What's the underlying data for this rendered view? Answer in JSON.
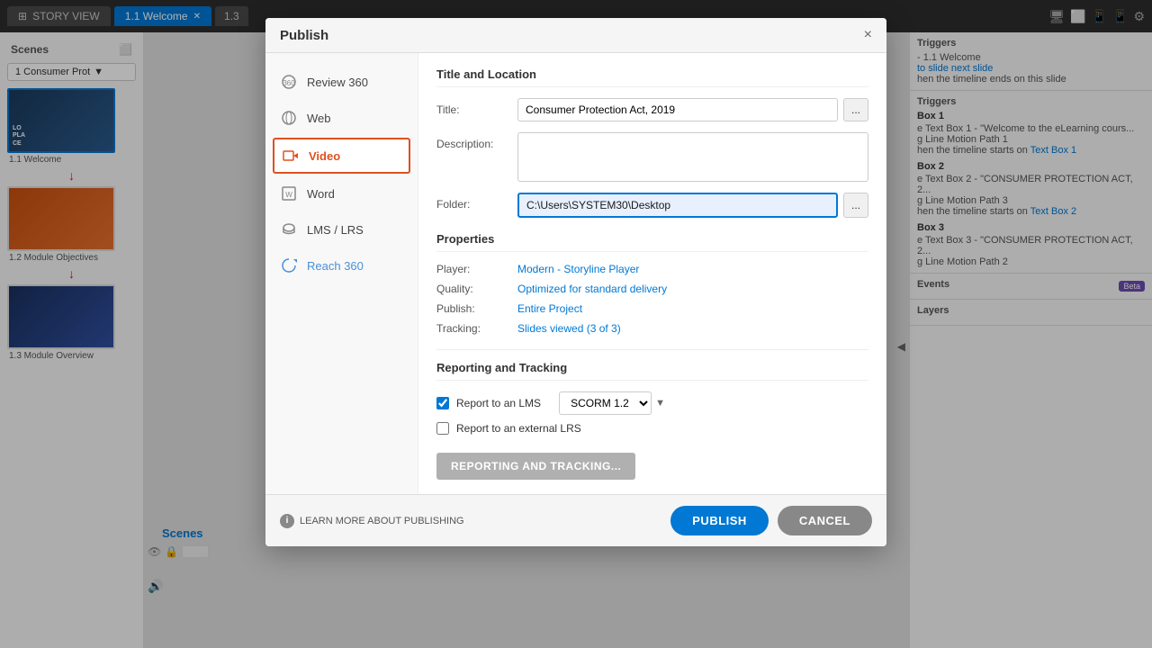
{
  "app": {
    "tabs": [
      {
        "label": "STORY VIEW",
        "icon": "story-icon"
      },
      {
        "label": "1.1 Welcome",
        "active": true
      },
      {
        "label": "1.3",
        "active": false
      }
    ],
    "header_icons": [
      "monitor-icon",
      "square-icon",
      "tablet-icon",
      "phone-icon",
      "gear-icon"
    ]
  },
  "sidebar": {
    "title": "Scenes",
    "scene_selector": "1 Consumer Prot",
    "slides": [
      {
        "label": "1.1 Welcome",
        "active": true
      },
      {
        "label": "1.2 Module Objectives",
        "active": false
      },
      {
        "label": "1.3 Module Overview",
        "active": false
      }
    ]
  },
  "right_panel": {
    "sections": [
      {
        "title": "rs",
        "items": [
          "- 1.1 Welcome",
          "to slide next slide",
          "hen the timeline ends on this slide"
        ]
      },
      {
        "title": "riggers",
        "subsections": [
          {
            "label": "Box 1",
            "items": [
              "e Text Box 1 - \"Welcome to the eLearning cours...",
              "g Line Motion Path 1",
              "hen the timeline starts on Text Box 1"
            ]
          },
          {
            "label": "Box 2",
            "items": [
              "e Text Box 2 - \"CONSUMER PROTECTION ACT, 2...",
              "g Line Motion Path 3",
              "hen the timeline starts on Text Box 2"
            ]
          },
          {
            "label": "Box 3",
            "items": [
              "e Text Box 3 - \"CONSUMER PROTECTION ACT, 2...",
              "g Line Motion Path 2"
            ]
          }
        ]
      },
      {
        "title": "ents",
        "badge": "Beta"
      },
      {
        "title": "ayers"
      }
    ]
  },
  "modal": {
    "title": "Publish",
    "close_label": "×",
    "nav_items": [
      {
        "label": "Review 360",
        "icon": "review-icon"
      },
      {
        "label": "Web",
        "icon": "web-icon"
      },
      {
        "label": "Video",
        "icon": "video-icon",
        "active": true
      },
      {
        "label": "Word",
        "icon": "word-icon"
      },
      {
        "label": "LMS / LRS",
        "icon": "lms-icon"
      },
      {
        "label": "Reach 360",
        "icon": "reach-icon"
      }
    ],
    "form": {
      "section_title": "Title and Location",
      "title_label": "Title:",
      "title_value": "Consumer Protection Act, 2019",
      "description_label": "Description:",
      "description_value": "",
      "folder_label": "Folder:",
      "folder_value": "C:\\Users\\SYSTEM30\\Desktop",
      "browse_label": "...",
      "browse_label2": "..."
    },
    "properties": {
      "section_title": "Properties",
      "player_label": "Player:",
      "player_value": "Modern - Storyline Player",
      "quality_label": "Quality:",
      "quality_value": "Optimized for standard delivery",
      "publish_label": "Publish:",
      "publish_value": "Entire Project",
      "tracking_label": "Tracking:",
      "tracking_value": "Slides viewed (3 of 3)"
    },
    "reporting": {
      "section_title": "Reporting and Tracking",
      "report_lms_label": "Report to an LMS",
      "report_lms_checked": true,
      "scorm_value": "SCORM 1.2",
      "report_external_label": "Report to an external LRS",
      "report_external_checked": false,
      "btn_label": "REPORTING AND TRACKING..."
    },
    "footer": {
      "info_text": "LEARN MORE ABOUT PUBLISHING",
      "publish_btn": "PUBLISH",
      "cancel_btn": "CANCEL"
    }
  }
}
